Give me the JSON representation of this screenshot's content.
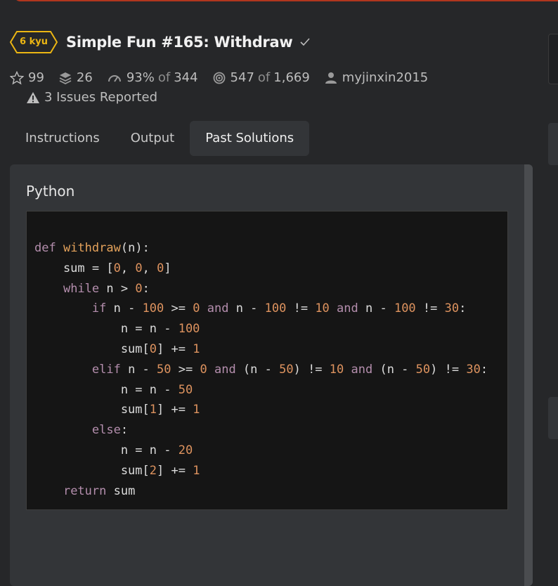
{
  "kata": {
    "rank": "6 kyu",
    "title": "Simple Fun #165: Withdraw",
    "rank_color": "#ecb613"
  },
  "stats": {
    "stars": "99",
    "collections": "26",
    "satisfaction": "93%",
    "of_word": "of",
    "votes": "344",
    "completed": "547",
    "completed_of": "of",
    "attempts": "1,669",
    "author": "myjinxin2015",
    "issues": "3 Issues Reported"
  },
  "tabs": [
    {
      "label": "Instructions"
    },
    {
      "label": "Output"
    },
    {
      "label": "Past Solutions"
    }
  ],
  "solution": {
    "language": "Python",
    "code": [
      [
        {
          "t": "def",
          "c": "kw"
        },
        {
          "t": " "
        },
        {
          "t": "withdraw",
          "c": "fn"
        },
        {
          "t": "(n):"
        }
      ],
      [
        {
          "t": "    sum = ["
        },
        {
          "t": "0",
          "c": "num"
        },
        {
          "t": ", "
        },
        {
          "t": "0",
          "c": "num"
        },
        {
          "t": ", "
        },
        {
          "t": "0",
          "c": "num"
        },
        {
          "t": "]"
        }
      ],
      [
        {
          "t": "    "
        },
        {
          "t": "while",
          "c": "kw"
        },
        {
          "t": " n > "
        },
        {
          "t": "0",
          "c": "num"
        },
        {
          "t": ":"
        }
      ],
      [
        {
          "t": "        "
        },
        {
          "t": "if",
          "c": "kw"
        },
        {
          "t": " n - "
        },
        {
          "t": "100",
          "c": "num"
        },
        {
          "t": " >= "
        },
        {
          "t": "0",
          "c": "num"
        },
        {
          "t": " "
        },
        {
          "t": "and",
          "c": "kw"
        },
        {
          "t": " n - "
        },
        {
          "t": "100",
          "c": "num"
        },
        {
          "t": " != "
        },
        {
          "t": "10",
          "c": "num"
        },
        {
          "t": " "
        },
        {
          "t": "and",
          "c": "kw"
        },
        {
          "t": " n - "
        },
        {
          "t": "100",
          "c": "num"
        },
        {
          "t": " != "
        },
        {
          "t": "30",
          "c": "num"
        },
        {
          "t": ":"
        }
      ],
      [
        {
          "t": "            n = n - "
        },
        {
          "t": "100",
          "c": "num"
        }
      ],
      [
        {
          "t": "            sum["
        },
        {
          "t": "0",
          "c": "num"
        },
        {
          "t": "] += "
        },
        {
          "t": "1",
          "c": "num"
        }
      ],
      [
        {
          "t": "        "
        },
        {
          "t": "elif",
          "c": "kw"
        },
        {
          "t": " n - "
        },
        {
          "t": "50",
          "c": "num"
        },
        {
          "t": " >= "
        },
        {
          "t": "0",
          "c": "num"
        },
        {
          "t": " "
        },
        {
          "t": "and",
          "c": "kw"
        },
        {
          "t": " (n - "
        },
        {
          "t": "50",
          "c": "num"
        },
        {
          "t": ") != "
        },
        {
          "t": "10",
          "c": "num"
        },
        {
          "t": " "
        },
        {
          "t": "and",
          "c": "kw"
        },
        {
          "t": " (n - "
        },
        {
          "t": "50",
          "c": "num"
        },
        {
          "t": ") != "
        },
        {
          "t": "30",
          "c": "num"
        },
        {
          "t": ":"
        }
      ],
      [
        {
          "t": "            n = n - "
        },
        {
          "t": "50",
          "c": "num"
        }
      ],
      [
        {
          "t": "            sum["
        },
        {
          "t": "1",
          "c": "num"
        },
        {
          "t": "] += "
        },
        {
          "t": "1",
          "c": "num"
        }
      ],
      [
        {
          "t": "        "
        },
        {
          "t": "else",
          "c": "kw"
        },
        {
          "t": ":"
        }
      ],
      [
        {
          "t": "            n = n - "
        },
        {
          "t": "20",
          "c": "num"
        }
      ],
      [
        {
          "t": "            sum["
        },
        {
          "t": "2",
          "c": "num"
        },
        {
          "t": "] += "
        },
        {
          "t": "1",
          "c": "num"
        }
      ],
      [
        {
          "t": "    "
        },
        {
          "t": "return",
          "c": "kw"
        },
        {
          "t": " sum"
        }
      ]
    ]
  },
  "icons": {
    "check": "check-icon",
    "star": "star-icon",
    "collections": "stack-icon",
    "satisfaction": "gauge-icon",
    "completed": "target-icon",
    "author": "user-icon",
    "issues": "warning-icon"
  }
}
